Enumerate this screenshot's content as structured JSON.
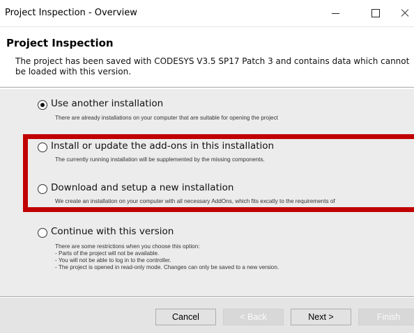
{
  "window": {
    "title": "Project Inspection - Overview",
    "controls": {
      "minimize": "—",
      "maximize": "☐",
      "close": "X"
    }
  },
  "header": {
    "title": "Project Inspection",
    "description": "The project has been saved with CODESYS V3.5 SP17 Patch 3 and contains data which cannot be loaded with this version."
  },
  "options": [
    {
      "label": "Use another installation",
      "selected": true,
      "description": [
        "There are already installations on your computer that are suitable for opening the project"
      ]
    },
    {
      "label": "Install or update the add-ons in this installation",
      "selected": false,
      "description": [
        "The currently running installation will be supplemented by the missing components."
      ]
    },
    {
      "label": "Download and setup a new installation",
      "selected": false,
      "description": [
        "We create an installation on your computer with all necessary AddOns, which fits excatly to the requirements of"
      ]
    },
    {
      "label": "Continue with this version",
      "selected": false,
      "description": [
        "There are some restrictions when you choose this option:",
        "- Parts of the project will not be available.",
        "- You will not be able to log in to the controller.",
        "- The project is opened in read-only mode. Changes can only be saved to a new version."
      ]
    }
  ],
  "highlight_color": "#c00000",
  "buttons": {
    "cancel": "Cancel",
    "back": "< Back",
    "next": "Next >",
    "finish": "Finish"
  }
}
